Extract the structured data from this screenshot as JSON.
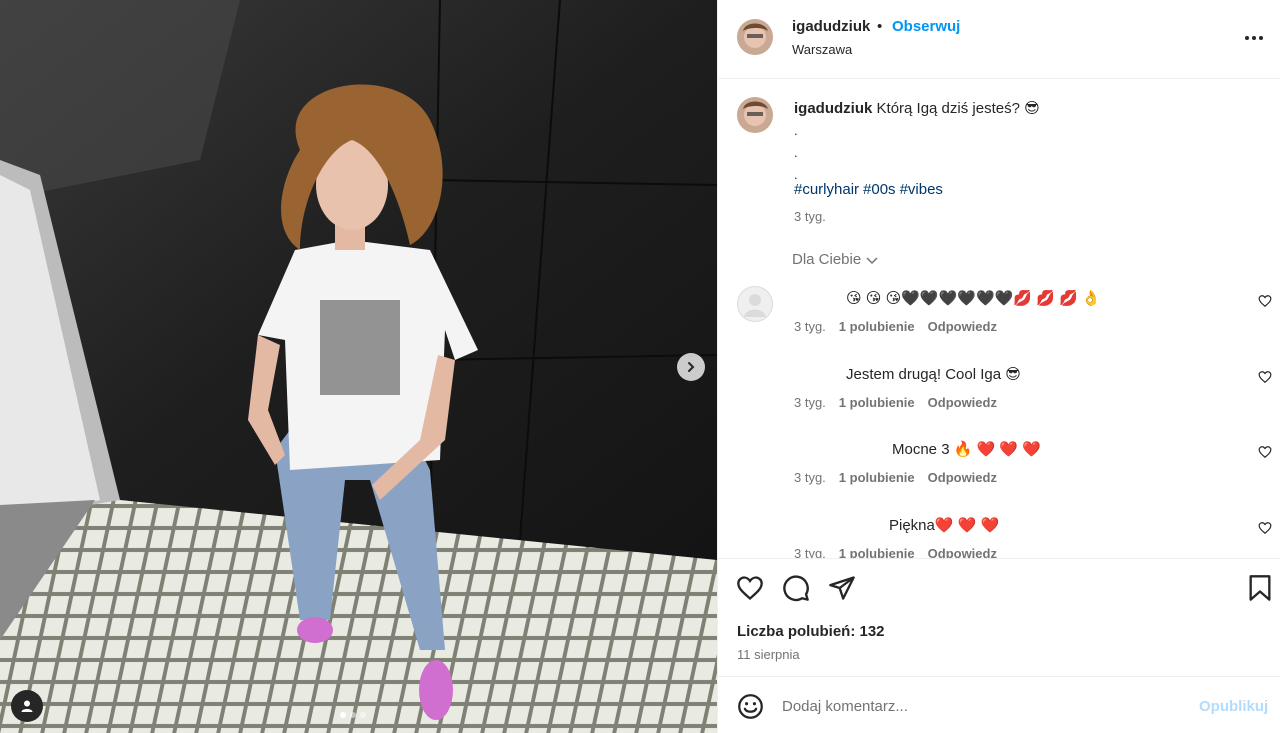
{
  "header": {
    "username": "igadudziuk",
    "bullet": "•",
    "follow_label": "Obserwuj",
    "location": "Warszawa"
  },
  "caption": {
    "username": "igadudziuk",
    "text": "Którą Igą dziś jesteś? 😎",
    "dots": [
      ".",
      ".",
      "."
    ],
    "hashtags": [
      "#curlyhair",
      "#00s",
      "#vibes"
    ],
    "time": "3 tyg."
  },
  "filter_label": "Dla Ciebie",
  "comments": [
    {
      "text": "😘 😘 😘🖤🖤🖤🖤🖤🖤💋 💋 💋 👌",
      "time": "3 tyg.",
      "likes": "1 polubienie",
      "reply": "Odpowiedz"
    },
    {
      "text": "Jestem drugą! Cool Iga 😎",
      "time": "3 tyg.",
      "likes": "1 polubienie",
      "reply": "Odpowiedz"
    },
    {
      "text": "Mocne 3 🔥 ❤️ ❤️ ❤️",
      "time": "3 tyg.",
      "likes": "1 polubienie",
      "reply": "Odpowiedz"
    },
    {
      "text": "Piękna❤️ ❤️ ❤️",
      "time": "3 tyg.",
      "likes": "1 polubienie",
      "reply": "Odpowiedz"
    }
  ],
  "likes_label": "Liczba polubień: 132",
  "date": "11 sierpnia",
  "add_comment": {
    "placeholder": "Dodaj komentarz...",
    "publish_label": "Opublikuj"
  },
  "icons": [
    "heart-icon",
    "comment-icon",
    "share-icon",
    "bookmark-icon",
    "emoji-icon",
    "more-icon",
    "chevron-right-icon",
    "chevron-down-icon",
    "user-tag-icon"
  ],
  "colors": {
    "accent": "#0095f6",
    "hashtag": "#00376b",
    "muted": "#737373",
    "publish_disabled": "#b3dbff"
  },
  "carousel": {
    "slide_count": 3,
    "active_slide": 1
  }
}
